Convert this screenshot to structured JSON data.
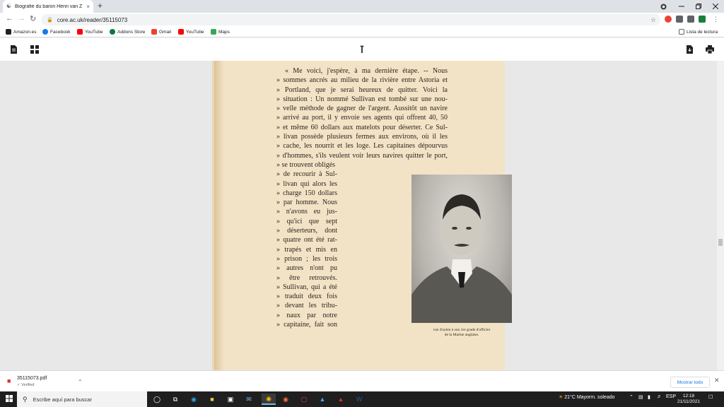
{
  "browser": {
    "tab_title": "Biografie du baron Henri van Z",
    "tab_close": "×",
    "new_tab": "+",
    "url": "core.ac.uk/reader/35115073",
    "reading_list": "Lista de lectura",
    "bookmarks": [
      {
        "label": "Amazon.es",
        "color": "#222222"
      },
      {
        "label": "Facebook",
        "color": "#1877f2"
      },
      {
        "label": "YouTube",
        "color": "#ff0000"
      },
      {
        "label": "Addons Store",
        "color": "#0a7a3b"
      },
      {
        "label": "Gmail",
        "color": "#ea4335"
      },
      {
        "label": "YouTube",
        "color": "#ff0000"
      },
      {
        "label": "Maps",
        "color": "#34a853"
      }
    ]
  },
  "document": {
    "lines": [
      "« Me voici, j'espère, à ma dernière étape. -- Nous",
      "» sommes ancrés au milieu de la rivière entre Astoria et",
      "» Portland, que je serai heureux de quitter. Voici la",
      "» situation : Un nommé Sullivan est tombé sur une nou-",
      "» velle méthode de gagner de l'argent. Aussitôt un navire",
      "» arrivé au port, il y envoie ses agents qui offrent 40, 50",
      "» et même 60 dollars aux matelots pour déserter. Ce Sul-",
      "» livan possède plusieurs fermes aux environs, où il les",
      "» cache, les nourrit et les loge. Les capitaines dépourvus",
      "» d'hommes, s'ils veulent voir leurs navires quitter le port,"
    ],
    "short_lines": [
      "» se trouvent obligés",
      "» de recourir à Sul-",
      "» livan qui alors les",
      "» charge 150 dollars",
      "» par homme. Nous",
      "» n'avons eu jus-",
      "» qu'ici que sept",
      "» déserteurs, dont",
      "» quatre ont été rat-",
      "» trapés et mis en",
      "» prison ; les trois",
      "» autres n'ont pu",
      "» être retrouvés.",
      "» Sullivan, qui a été",
      "» traduit deux fois",
      "» devant les tribu-",
      "» naux par notre",
      "» capitaine, fait son"
    ],
    "caption_line1": "van Zuylen à son 1er grade d'officier",
    "caption_line2": "de la Marine anglaise."
  },
  "downloads": {
    "file_name": "35115073.pdf",
    "status": "Verified",
    "show_all": "Mostrar todo"
  },
  "taskbar": {
    "search_placeholder": "Escribe aquí para buscar",
    "weather": "21°C  Mayorm. soleado",
    "language": "ESP",
    "time": "12:18",
    "date": "21/11/2021"
  }
}
